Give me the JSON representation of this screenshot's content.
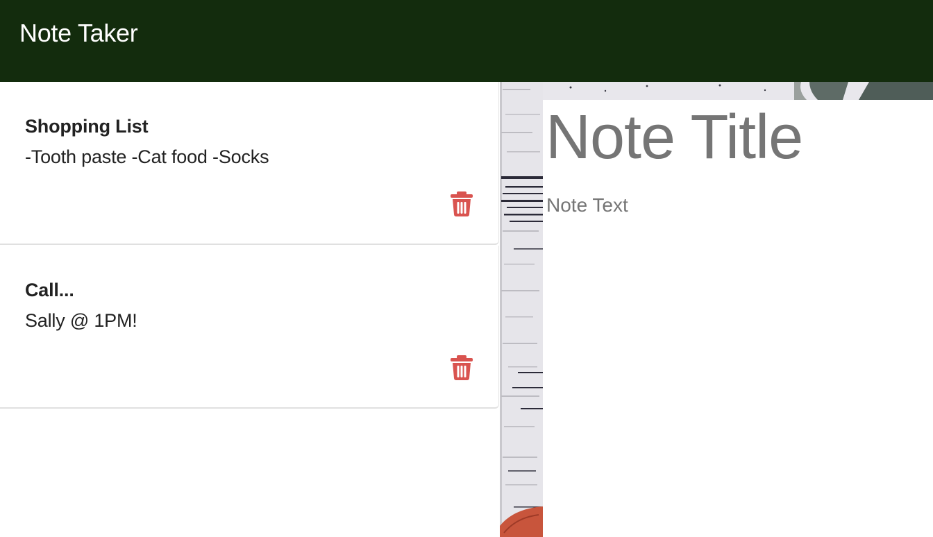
{
  "app": {
    "title": "Note Taker",
    "accent_color": "#132c0d",
    "delete_icon_color": "#d9534f"
  },
  "notes": [
    {
      "title": "Shopping List",
      "text": "-Tooth paste -Cat food -Socks"
    },
    {
      "title": "Call...",
      "text": "Sally @ 1PM!"
    }
  ],
  "editor": {
    "title_placeholder": "Note Title",
    "text_placeholder": "Note Text"
  },
  "icons": {
    "delete": "trash-icon"
  }
}
